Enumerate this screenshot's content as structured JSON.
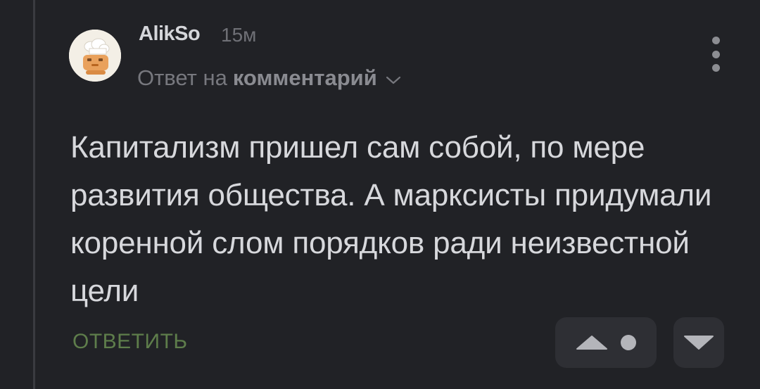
{
  "comment": {
    "author": "AlikSo",
    "time": "15м",
    "reply_prefix": "Ответ на",
    "reply_target": "комментарий",
    "text": "Капитализм пришел сам собой, по мере развития общества. А марксисты придумали коренной слом порядков ради неизвестной цели",
    "reply_label": "ОТВЕТИТЬ"
  },
  "icons": {
    "avatar": "cook-avatar-icon",
    "chevron": "chevron-down-icon",
    "more": "more-vertical-icon",
    "upvote": "triangle-up-icon",
    "rating_hidden": "dot-icon",
    "downvote": "triangle-down-icon"
  },
  "colors": {
    "background": "#212226",
    "text": "#d7d8dc",
    "muted": "#77787e",
    "reply_green": "#5e7d4b",
    "vote_box": "#2e2f34"
  }
}
